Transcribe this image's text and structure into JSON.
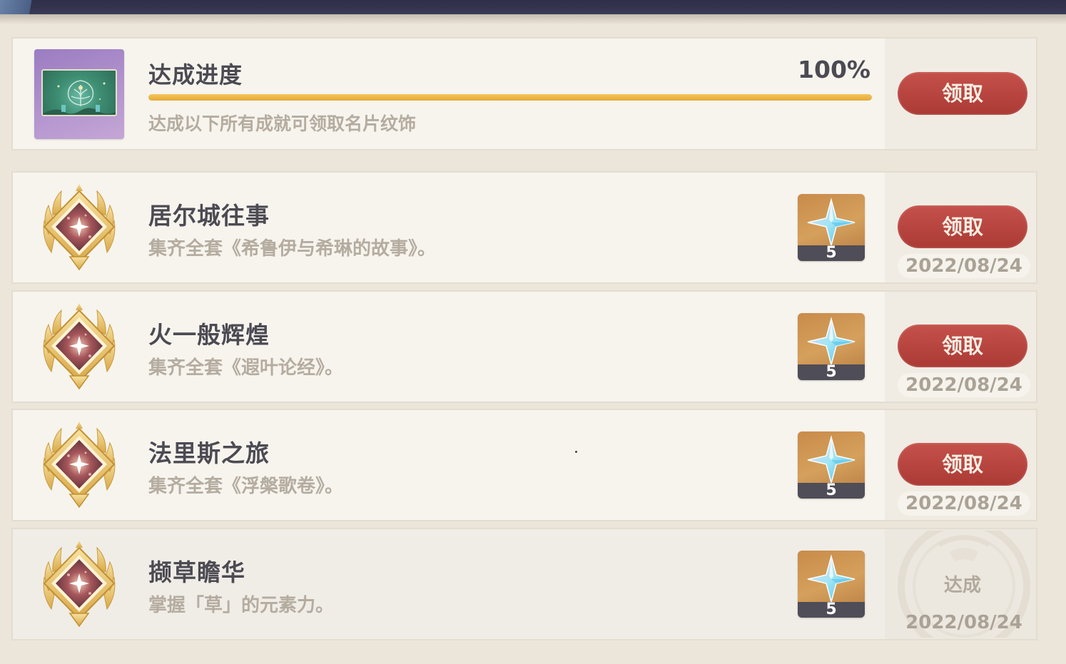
{
  "progress": {
    "title": "达成进度",
    "percent_text": "100%",
    "percent_value": 100,
    "description": "达成以下所有成就可领取名片纹饰",
    "claim_label": "领取",
    "icon": "namecard-icon"
  },
  "achievements": [
    {
      "title": "居尔城往事",
      "description": "集齐全套《希鲁伊与希琳的故事》。",
      "reward_count": "5",
      "reward_icon": "primogem-icon",
      "action_label": "领取",
      "date": "2022/08/24",
      "status": "claimable"
    },
    {
      "title": "火一般辉煌",
      "description": "集齐全套《遐叶论经》。",
      "reward_count": "5",
      "reward_icon": "primogem-icon",
      "action_label": "领取",
      "date": "2022/08/24",
      "status": "claimable"
    },
    {
      "title": "法里斯之旅",
      "description": "集齐全套《浮槃歌卷》。",
      "reward_count": "5",
      "reward_icon": "primogem-icon",
      "action_label": "领取",
      "date": "2022/08/24",
      "status": "claimable"
    },
    {
      "title": "撷草瞻华",
      "description": "掌握「草」的元素力。",
      "reward_count": "5",
      "reward_icon": "primogem-icon",
      "action_label": "达成",
      "date": "2022/08/24",
      "status": "achieved"
    }
  ],
  "colors": {
    "claim_button": "#b9433e",
    "progress_fill": "#eab440",
    "title_text": "#4c4a52",
    "muted_text": "#b5aca0"
  }
}
